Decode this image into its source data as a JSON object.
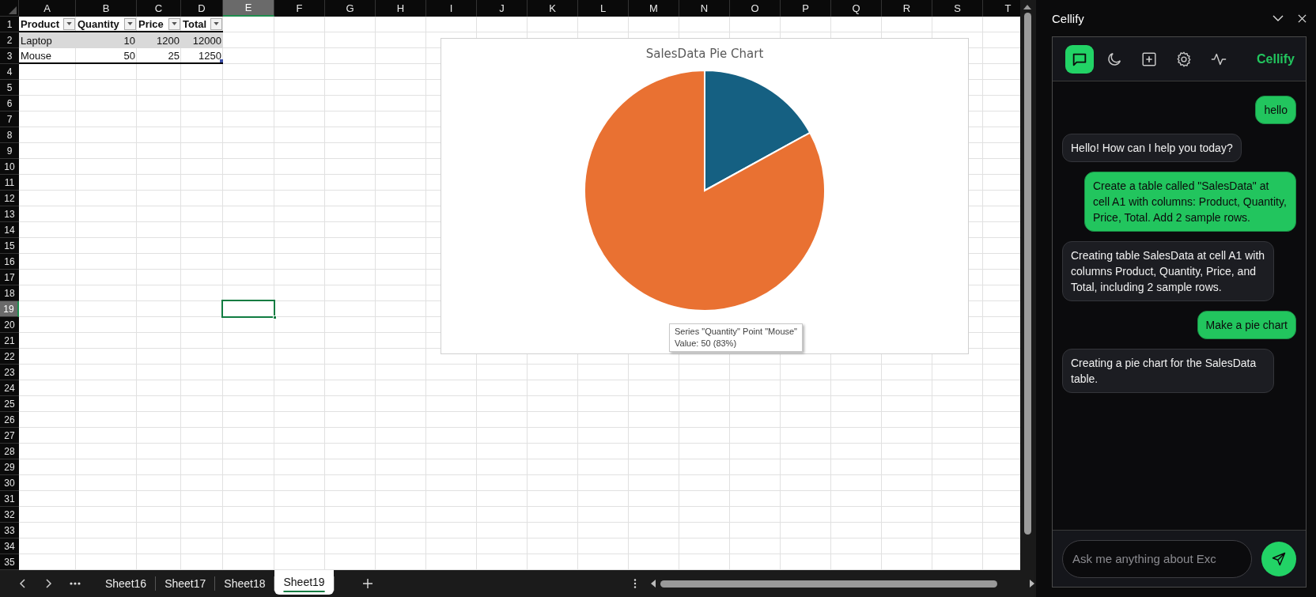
{
  "sheet": {
    "columns": [
      {
        "label": "A",
        "selected": false
      },
      {
        "label": "B",
        "selected": false
      },
      {
        "label": "C",
        "selected": false
      },
      {
        "label": "D",
        "selected": false
      },
      {
        "label": "E",
        "selected": true
      },
      {
        "label": "F",
        "selected": false
      },
      {
        "label": "G",
        "selected": false
      },
      {
        "label": "H",
        "selected": false
      },
      {
        "label": "I",
        "selected": false
      },
      {
        "label": "J",
        "selected": false
      },
      {
        "label": "K",
        "selected": false
      },
      {
        "label": "L",
        "selected": false
      },
      {
        "label": "M",
        "selected": false
      },
      {
        "label": "N",
        "selected": false
      },
      {
        "label": "O",
        "selected": false
      },
      {
        "label": "P",
        "selected": false
      },
      {
        "label": "Q",
        "selected": false
      },
      {
        "label": "R",
        "selected": false
      },
      {
        "label": "S",
        "selected": false
      },
      {
        "label": "T",
        "selected": false
      }
    ],
    "rows": [
      {
        "label": "1",
        "selected": false
      },
      {
        "label": "2",
        "selected": false
      },
      {
        "label": "3",
        "selected": false
      },
      {
        "label": "4",
        "selected": false
      },
      {
        "label": "5",
        "selected": false
      },
      {
        "label": "6",
        "selected": false
      },
      {
        "label": "7",
        "selected": false
      },
      {
        "label": "8",
        "selected": false
      },
      {
        "label": "9",
        "selected": false
      },
      {
        "label": "10",
        "selected": false
      },
      {
        "label": "11",
        "selected": false
      },
      {
        "label": "12",
        "selected": false
      },
      {
        "label": "13",
        "selected": false
      },
      {
        "label": "14",
        "selected": false
      },
      {
        "label": "15",
        "selected": false
      },
      {
        "label": "16",
        "selected": false
      },
      {
        "label": "17",
        "selected": false
      },
      {
        "label": "18",
        "selected": false
      },
      {
        "label": "19",
        "selected": true
      },
      {
        "label": "20",
        "selected": false
      },
      {
        "label": "21",
        "selected": false
      },
      {
        "label": "22",
        "selected": false
      },
      {
        "label": "23",
        "selected": false
      },
      {
        "label": "24",
        "selected": false
      },
      {
        "label": "25",
        "selected": false
      },
      {
        "label": "26",
        "selected": false
      },
      {
        "label": "27",
        "selected": false
      },
      {
        "label": "28",
        "selected": false
      },
      {
        "label": "29",
        "selected": false
      },
      {
        "label": "30",
        "selected": false
      },
      {
        "label": "31",
        "selected": false
      },
      {
        "label": "32",
        "selected": false
      },
      {
        "label": "33",
        "selected": false
      },
      {
        "label": "34",
        "selected": false
      },
      {
        "label": "35",
        "selected": false
      }
    ],
    "table": {
      "headers": [
        "Product",
        "Quantity",
        "Price",
        "Total"
      ],
      "rows": [
        {
          "cells": [
            "Laptop",
            "10",
            "1200",
            "12000"
          ],
          "banded": true
        },
        {
          "cells": [
            "Mouse",
            "50",
            "25",
            "1250"
          ],
          "banded": false
        }
      ]
    },
    "chart": {
      "title": "SalesData Pie Chart",
      "chart_data": {
        "type": "pie",
        "series": [
          {
            "values": [
              17,
              83
            ]
          }
        ],
        "colors": [
          "#156082",
          "#e97132"
        ]
      },
      "tooltip": [
        "Series \"Quantity\" Point \"Mouse\"",
        "Value: 50 (83%)"
      ]
    }
  },
  "sheet_tabs": [
    {
      "label": "Sheet16",
      "selected": false
    },
    {
      "label": "Sheet17",
      "selected": false
    },
    {
      "label": "Sheet18",
      "selected": false
    },
    {
      "label": "Sheet19",
      "selected": true
    }
  ],
  "panel": {
    "title": "Cellify",
    "toolbar": [
      {
        "kind": "chat",
        "selected": true
      },
      {
        "kind": "moon",
        "selected": false
      },
      {
        "kind": "add",
        "selected": false
      },
      {
        "kind": "settings",
        "selected": false
      },
      {
        "kind": "activity",
        "selected": false
      }
    ],
    "brand": "Cellify",
    "messages": [
      {
        "kind": "user",
        "text": "hello"
      },
      {
        "kind": "assistant",
        "text": "Hello! How can I help you today?"
      },
      {
        "kind": "user",
        "text": "Create a table called \"SalesData\" at cell A1 with columns: Product, Quantity, Price, Total. Add 2 sample rows."
      },
      {
        "kind": "assistant",
        "text": "Creating table SalesData at cell A1 with columns Product, Quantity, Price, and Total, including 2 sample rows."
      },
      {
        "kind": "user",
        "text": "Make a pie chart"
      },
      {
        "kind": "assistant",
        "text": "Creating a pie chart for the SalesData table."
      }
    ],
    "input": {
      "placeholder": "Ask me anything about Exc"
    }
  }
}
